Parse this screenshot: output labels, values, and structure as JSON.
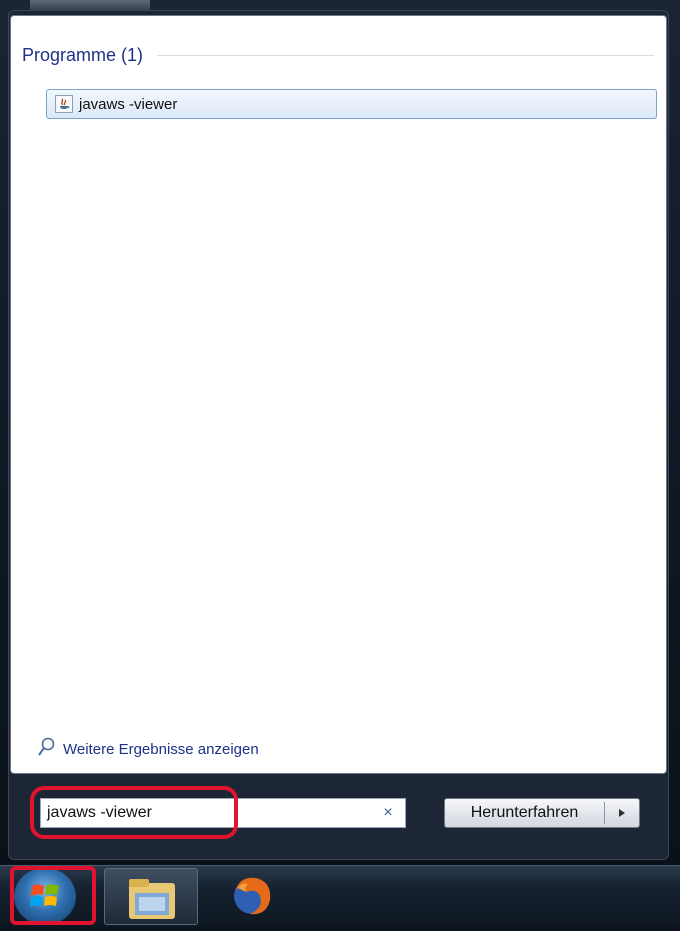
{
  "start_menu": {
    "group_title": "Programme (1)",
    "results": [
      {
        "label": "javaws -viewer",
        "icon": "java-icon"
      }
    ],
    "more_results_label": "Weitere Ergebnisse anzeigen",
    "search": {
      "value": "javaws -viewer",
      "clear_symbol": "×"
    },
    "shutdown_label": "Herunterfahren"
  },
  "taskbar": {
    "items": [
      {
        "name": "start-orb",
        "icon": "windows-logo-icon"
      },
      {
        "name": "explorer",
        "icon": "folder-icon"
      },
      {
        "name": "firefox",
        "icon": "firefox-icon"
      }
    ]
  },
  "colors": {
    "link": "#1e3287",
    "highlight": "#e0142e",
    "selection_border": "#7da2ce"
  }
}
